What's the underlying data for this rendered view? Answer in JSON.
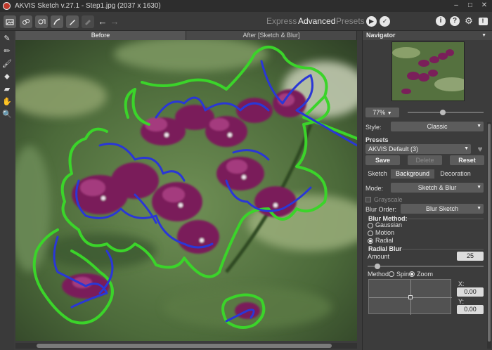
{
  "window": {
    "title": "AKVIS Sketch v.27.1 - Step1.jpg (2037 x 1630)"
  },
  "toolbar": {
    "modes": [
      "Express",
      "Advanced",
      "Presets"
    ],
    "active_mode": "Advanced"
  },
  "canvas": {
    "tabs": [
      "Before",
      "After [Sketch & Blur]"
    ],
    "active_tab": "Before"
  },
  "navigator": {
    "title": "Navigator",
    "zoom": "77%"
  },
  "style": {
    "label": "Style:",
    "value": "Classic"
  },
  "presets": {
    "label": "Presets",
    "value": "AKVIS Default (3)",
    "save": "Save",
    "delete": "Delete",
    "reset": "Reset"
  },
  "panel_tabs": [
    "Sketch",
    "Background",
    "Decoration"
  ],
  "active_panel_tab": "Background",
  "mode": {
    "label": "Mode:",
    "value": "Sketch & Blur"
  },
  "grayscale": {
    "label": "Grayscale",
    "checked": false
  },
  "blur_order": {
    "label": "Blur Order:",
    "value": "Blur Sketch"
  },
  "blur_method": {
    "title": "Blur Method:",
    "options": [
      "Gaussian",
      "Motion",
      "Radial"
    ],
    "selected": "Radial"
  },
  "radial_blur": {
    "title": "Radial Blur",
    "amount_label": "Amount",
    "amount": "25",
    "method_label": "Method:",
    "method_options": [
      "Spin",
      "Zoom"
    ],
    "method_selected": "Zoom",
    "x_label": "X:",
    "x": "0.00",
    "y_label": "Y:",
    "y": "0.00"
  }
}
